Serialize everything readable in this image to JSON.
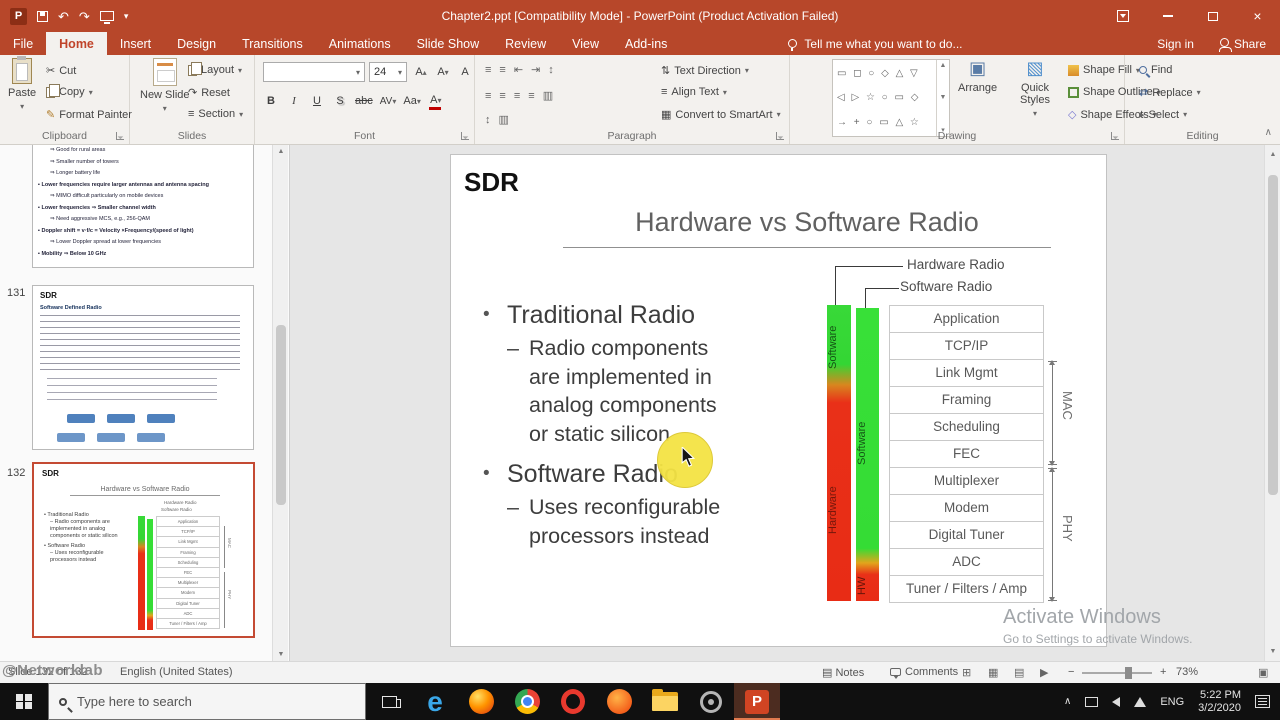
{
  "titlebar": {
    "title": "Chapter2.ppt [Compatibility Mode] - PowerPoint (Product Activation Failed)"
  },
  "ribbon": {
    "tabs": [
      "File",
      "Home",
      "Insert",
      "Design",
      "Transitions",
      "Animations",
      "Slide Show",
      "Review",
      "View",
      "Add-ins"
    ],
    "active_tab": "Home",
    "tell_me": "Tell me what you want to do...",
    "sign_in": "Sign in",
    "share": "Share",
    "clipboard": {
      "label": "Clipboard",
      "paste": "Paste",
      "cut": "Cut",
      "copy": "Copy",
      "format_painter": "Format Painter"
    },
    "slides": {
      "label": "Slides",
      "new_slide": "New Slide",
      "layout": "Layout",
      "reset": "Reset",
      "section": "Section"
    },
    "font": {
      "label": "Font",
      "font_name_value": "",
      "size_value": "24"
    },
    "paragraph": {
      "label": "Paragraph",
      "text_direction": "Text Direction",
      "align_text": "Align Text",
      "convert_smartart": "Convert to SmartArt"
    },
    "drawing": {
      "label": "Drawing",
      "arrange": "Arrange",
      "quick_styles": "Quick Styles",
      "shape_fill": "Shape Fill",
      "shape_outline": "Shape Outline",
      "shape_effects": "Shape Effects"
    },
    "editing": {
      "label": "Editing",
      "find": "Find",
      "replace": "Replace",
      "select": "Select"
    }
  },
  "icons": {
    "undo": "↶",
    "redo": "↷",
    "dropdown": "▾",
    "close": "×",
    "cut": "✂",
    "format_painter": "✎",
    "up_small": "▴",
    "scroll_up": "▲",
    "scroll_down": "▼",
    "bold": "B",
    "italic": "I",
    "underline": "U",
    "shadow": "S",
    "strikethrough": "abc",
    "char_spacing": "AV",
    "change_case": "Aa",
    "font_color": "A",
    "clear_format": "A",
    "bullets": "≡",
    "numbering": "≡",
    "indent_less": "⇤",
    "indent_more": "⇥",
    "line_spacing": "↕",
    "columns": "▥",
    "text_direction_glyph": "⇅",
    "align_glyph": "≡",
    "smartart": "▦",
    "shapes_row1": "▭ ◻ ○ ◇ △ ▽",
    "shapes_row2": "◁ ▷ ☆ ○ ▭ ◇",
    "shapes_row3": "→ + ○ ▭ △ ☆",
    "arrange": "▣",
    "quick_styles": "▧",
    "effects": "◇",
    "replace": "⇄",
    "select": "▸",
    "notes": "▤",
    "view_normal": "⊞",
    "view_sorter": "▦",
    "view_reading": "▤",
    "view_show": "▶",
    "minus": "−",
    "plus": "+",
    "collapse": "∧",
    "tray_chevron": "∧",
    "fit": "▣"
  },
  "thumbnails": {
    "partial_lines": [
      "⇒ Good for rural areas",
      "⇒ Smaller number of towers",
      "⇒ Longer battery life",
      "▪ Lower frequencies require larger antennas and antenna spacing",
      "⇒ MIMO difficult particularly on mobile devices",
      "▪ Lower frequencies ⇒ Smaller channel width",
      "⇒ Need aggressive MCS, e.g., 256-QAM",
      "▪ Doppler shift = v·f/c = Velocity ×Frequency/(speed of light)",
      "⇒ Lower Doppler spread at lower frequencies",
      "▪ Mobility ⇒ Below 10 GHz"
    ],
    "s131_number": "131",
    "s131_title": "SDR",
    "s131_subtitle": "Software Defined Radio",
    "s132_number": "132"
  },
  "slide": {
    "title": "SDR",
    "heading": "Hardware vs Software Radio",
    "marker_bullet": "•",
    "marker_dash": "–",
    "bullet1": "Traditional Radio",
    "sub1": "Radio components are implemented in analog components or static silicon",
    "bullet2": "Software Radio",
    "sub2": "Uses reconfigurable processors instead",
    "diagram": {
      "label_hw": "Hardware Radio",
      "label_sw": "Software Radio",
      "bar_left_top": "Software",
      "bar_left_bottom": "Hardware",
      "bar_right_top": "Software",
      "bar_right_bottom": "HW",
      "layers": [
        "Application",
        "TCP/IP",
        "Link Mgmt",
        "Framing",
        "Scheduling",
        "FEC",
        "Multiplexer",
        "Modem",
        "Digital Tuner",
        "ADC",
        "Tuner / Filters / Amp"
      ],
      "mac": "MAC",
      "phy": "PHY"
    }
  },
  "watermark": {
    "line1": "Activate Windows",
    "line2": "Go to Settings to activate Windows.",
    "networklab": "@Networklab"
  },
  "status": {
    "slide_info": "Slide 132 of 132",
    "language": "English (United States)",
    "notes": "Notes",
    "comments": "Comments",
    "zoom": "73%"
  },
  "taskbar": {
    "search": "Type here to search",
    "lang": "ENG",
    "time": "5:22 PM",
    "date": "3/2/2020"
  },
  "colors": {
    "accent_red": "#b7472a",
    "bar_green": "#38dc38",
    "bar_red": "#e82c15",
    "selection_border": "#c44a33"
  }
}
